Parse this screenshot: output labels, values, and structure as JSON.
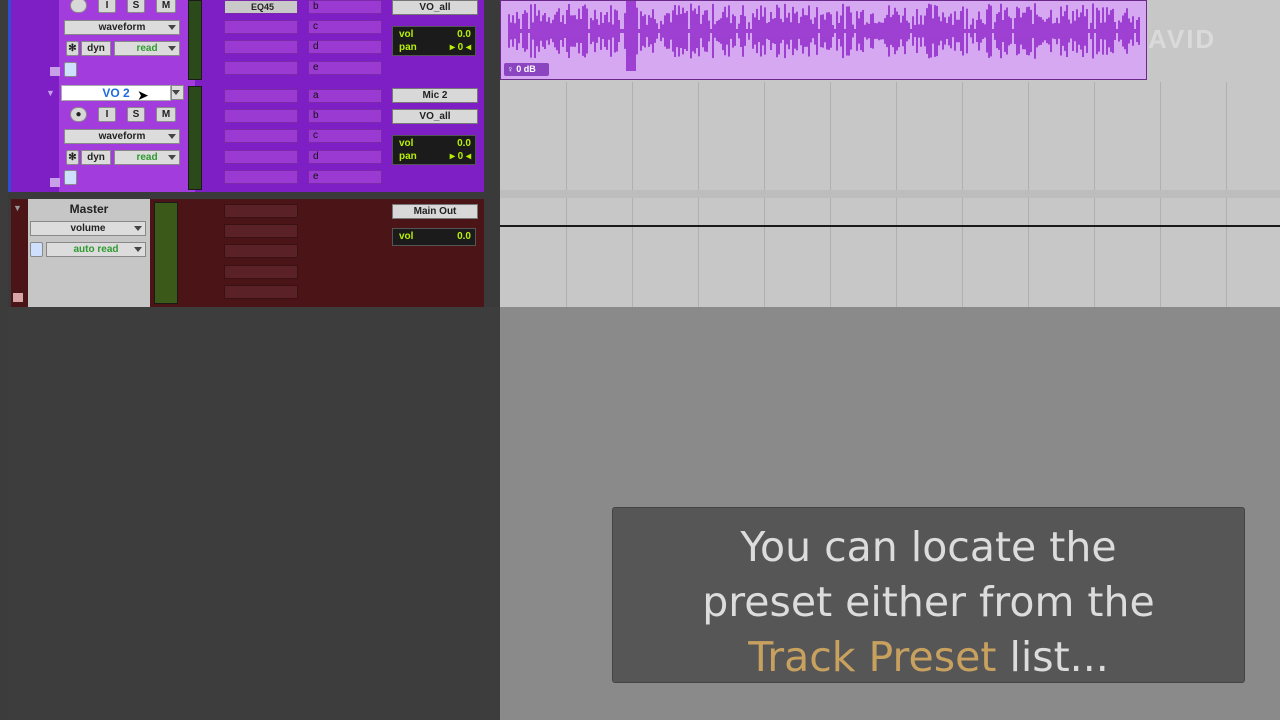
{
  "tracks": [
    {
      "name": "",
      "view": "waveform",
      "automation": "read",
      "dyn": "dyn",
      "inserts": [
        "EQ45",
        "",
        "",
        ""
      ],
      "sends": [
        "b",
        "c",
        "d",
        "e"
      ],
      "output": "VO_all",
      "vol": "0.0",
      "pan": "0"
    },
    {
      "name": "VO 2",
      "view": "waveform",
      "automation": "read",
      "dyn": "dyn",
      "inserts": [
        "",
        "",
        "",
        "",
        ""
      ],
      "sends": [
        "a",
        "b",
        "c",
        "d",
        "e"
      ],
      "input": "Mic 2",
      "output": "VO_all",
      "vol": "0.0",
      "pan": "0"
    }
  ],
  "master": {
    "name": "Master",
    "view": "volume",
    "automation": "auto read",
    "output": "Main Out",
    "vol": "0.0"
  },
  "buttons": {
    "record": "",
    "input": "I",
    "solo": "S",
    "mute": "M"
  },
  "labels": {
    "vol": "vol",
    "pan": "pan"
  },
  "clip": {
    "gain": "0 dB"
  },
  "logo": "AVID",
  "caption": {
    "line1": "You can locate the",
    "line2": "preset either from the",
    "highlight": "Track Preset",
    "tail": " list..."
  },
  "colors": {
    "track": "#7d1fc5",
    "clip": "#d7a8f2",
    "waveform": "#8a1ec8",
    "master": "#4b1518",
    "highlight": "#c9a15f"
  }
}
